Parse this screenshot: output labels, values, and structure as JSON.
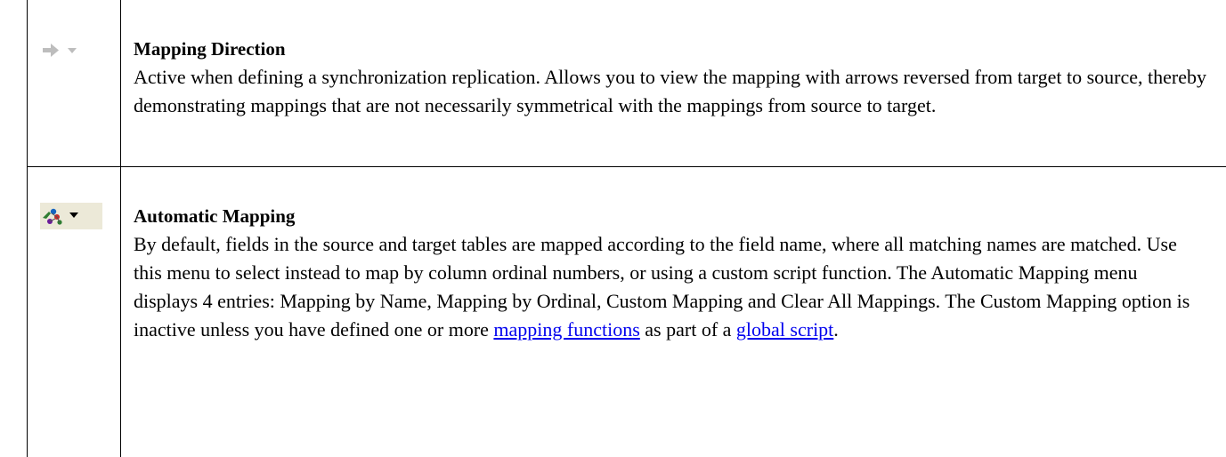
{
  "rows": [
    {
      "icon": "mapping-direction-arrow-icon",
      "title": "Mapping Direction",
      "description": "Active when defining a synchronization replication. Allows you to view the mapping with arrows reversed from target to source, thereby demonstrating mappings that are not necessarily symmetrical with the mappings from source to target."
    },
    {
      "icon": "automatic-mapping-icon",
      "title": "Automatic Mapping",
      "description_before": "By default, fields in the source and target tables are mapped according to the field name, where all matching names are matched. Use this menu to select instead to map by column ordinal numbers, or using a custom script function. The Automatic Mapping menu displays 4 entries: Mapping by Name, Mapping by Ordinal, Custom Mapping and Clear All Mappings. The Custom Mapping option is inactive unless you have defined one or more ",
      "link1": "mapping functions",
      "description_middle": " as part of a ",
      "link2": "global script",
      "description_after": "."
    }
  ],
  "colors": {
    "link": "#0000ee",
    "disabled_icon": "#b4b4b4",
    "icon_bg": "#ece9d8"
  }
}
